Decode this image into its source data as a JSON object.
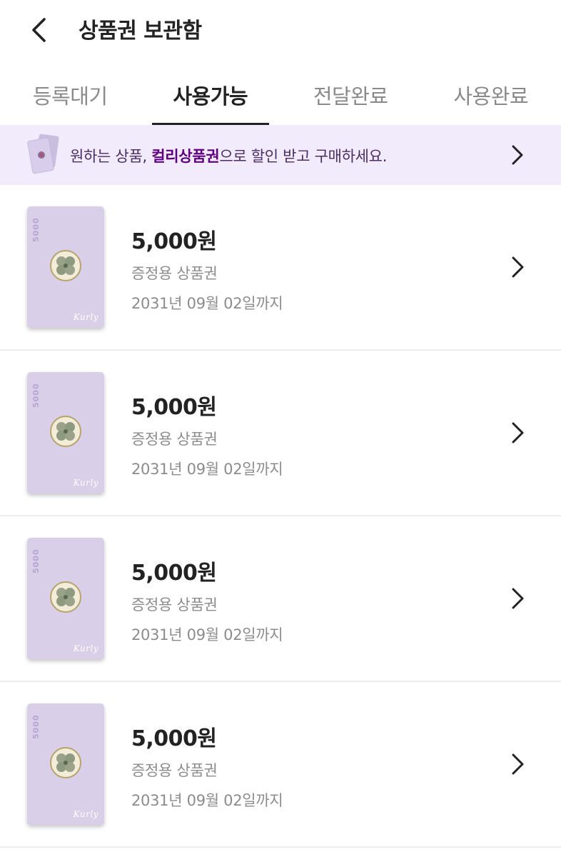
{
  "header": {
    "title": "상품권 보관함",
    "back_icon": "chevron-left-icon"
  },
  "tabs": [
    {
      "label": "등록대기",
      "active": false
    },
    {
      "label": "사용가능",
      "active": true
    },
    {
      "label": "전달완료",
      "active": false
    },
    {
      "label": "사용완료",
      "active": false
    }
  ],
  "promo": {
    "text_before": "원하는 상품, ",
    "text_highlight": "컬리상품권",
    "text_after": "으로 할인 받고 구매하세요.",
    "arrow_icon": "chevron-right-icon"
  },
  "vouchers": [
    {
      "card_value": "5000",
      "card_brand": "Kurly",
      "amount": "5,000원",
      "type": "증정용 상품권",
      "expiry": "2031년 09월 02일까지"
    },
    {
      "card_value": "5000",
      "card_brand": "Kurly",
      "amount": "5,000원",
      "type": "증정용 상품권",
      "expiry": "2031년 09월 02일까지"
    },
    {
      "card_value": "5000",
      "card_brand": "Kurly",
      "amount": "5,000원",
      "type": "증정용 상품권",
      "expiry": "2031년 09월 02일까지"
    },
    {
      "card_value": "5000",
      "card_brand": "Kurly",
      "amount": "5,000원",
      "type": "증정용 상품권",
      "expiry": "2031년 09월 02일까지"
    }
  ],
  "colors": {
    "accent": "#5f0080",
    "banner_bg": "#f1ebfb",
    "card_bg": "#d9cfe9"
  }
}
